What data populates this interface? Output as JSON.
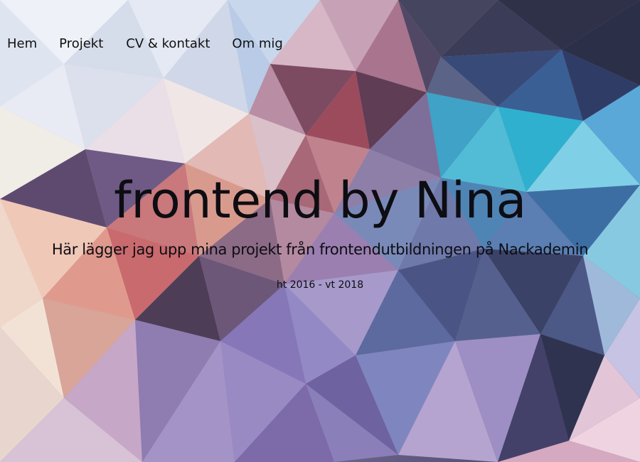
{
  "nav": {
    "items": [
      {
        "label": "Hem"
      },
      {
        "label": "Projekt"
      },
      {
        "label": "CV & kontakt"
      },
      {
        "label": "Om mig"
      }
    ]
  },
  "hero": {
    "title": "frontend by Nina",
    "subtitle": "Här lägger jag upp mina projekt från frontendutbildningen på Nackademin",
    "period": "ht 2016 - vt 2018"
  },
  "theme": {
    "background_palette": [
      "#dfe6f2",
      "#c9a9c2",
      "#8b6f99",
      "#c97a7a",
      "#e6b9a0",
      "#5a4a6e",
      "#3a3d59",
      "#2a9fc4",
      "#7fd0e6",
      "#9b93c9",
      "#f0e2d8"
    ]
  }
}
